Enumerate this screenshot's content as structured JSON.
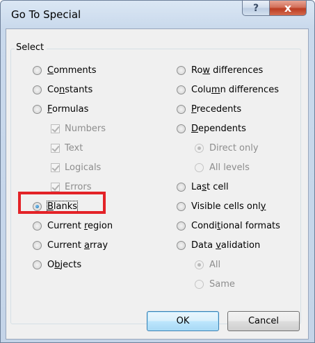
{
  "window": {
    "title": "Go To Special",
    "help_glyph": "?",
    "close_glyph": "x"
  },
  "group": {
    "label": "Select"
  },
  "left_column": [
    {
      "pre": "",
      "key": "C",
      "post": "omments",
      "type": "radio",
      "checked": false,
      "enabled": true
    },
    {
      "pre": "Co",
      "key": "n",
      "post": "stants",
      "type": "radio",
      "checked": false,
      "enabled": true
    },
    {
      "pre": "",
      "key": "F",
      "post": "ormulas",
      "type": "radio",
      "checked": false,
      "enabled": true
    },
    {
      "pre": "",
      "key": "",
      "post": "Numbers",
      "type": "checkbox",
      "checked": true,
      "enabled": false
    },
    {
      "pre": "",
      "key": "",
      "post": "Text",
      "type": "checkbox",
      "checked": true,
      "enabled": false
    },
    {
      "pre": "",
      "key": "",
      "post": "Logicals",
      "type": "checkbox",
      "checked": true,
      "enabled": false
    },
    {
      "pre": "",
      "key": "",
      "post": "Errors",
      "type": "checkbox",
      "checked": true,
      "enabled": false
    },
    {
      "pre": "",
      "key": "B",
      "post": "lanks",
      "type": "radio",
      "checked": true,
      "enabled": true
    },
    {
      "pre": "Current ",
      "key": "r",
      "post": "egion",
      "type": "radio",
      "checked": false,
      "enabled": true
    },
    {
      "pre": "Current ",
      "key": "a",
      "post": "rray",
      "type": "radio",
      "checked": false,
      "enabled": true
    },
    {
      "pre": "O",
      "key": "b",
      "post": "jects",
      "type": "radio",
      "checked": false,
      "enabled": true
    }
  ],
  "right_column": [
    {
      "pre": "Ro",
      "key": "w",
      "post": " differences",
      "type": "radio",
      "checked": false,
      "enabled": true
    },
    {
      "pre": "Colu",
      "key": "m",
      "post": "n differences",
      "type": "radio",
      "checked": false,
      "enabled": true
    },
    {
      "pre": "",
      "key": "P",
      "post": "recedents",
      "type": "radio",
      "checked": false,
      "enabled": true
    },
    {
      "pre": "",
      "key": "D",
      "post": "ependents",
      "type": "radio",
      "checked": false,
      "enabled": true
    },
    {
      "pre": "",
      "key": "",
      "post": "Direct only",
      "type": "radio",
      "checked": true,
      "enabled": false
    },
    {
      "pre": "",
      "key": "",
      "post": "All levels",
      "type": "radio",
      "checked": false,
      "enabled": false
    },
    {
      "pre": "La",
      "key": "s",
      "post": "t cell",
      "type": "radio",
      "checked": false,
      "enabled": true
    },
    {
      "pre": "Visible cells onl",
      "key": "y",
      "post": "",
      "type": "radio",
      "checked": false,
      "enabled": true
    },
    {
      "pre": "Condi",
      "key": "t",
      "post": "ional formats",
      "type": "radio",
      "checked": false,
      "enabled": true
    },
    {
      "pre": "Data ",
      "key": "v",
      "post": "alidation",
      "type": "radio",
      "checked": false,
      "enabled": true
    },
    {
      "pre": "",
      "key": "",
      "post": "All",
      "type": "radio",
      "checked": true,
      "enabled": false
    },
    {
      "pre": "",
      "key": "",
      "post": "Same",
      "type": "radio",
      "checked": false,
      "enabled": false
    }
  ],
  "buttons": {
    "ok_label": "OK",
    "cancel_label": "Cancel"
  },
  "colors": {
    "highlight": "#e32227",
    "accent": "#1a6fb3"
  }
}
